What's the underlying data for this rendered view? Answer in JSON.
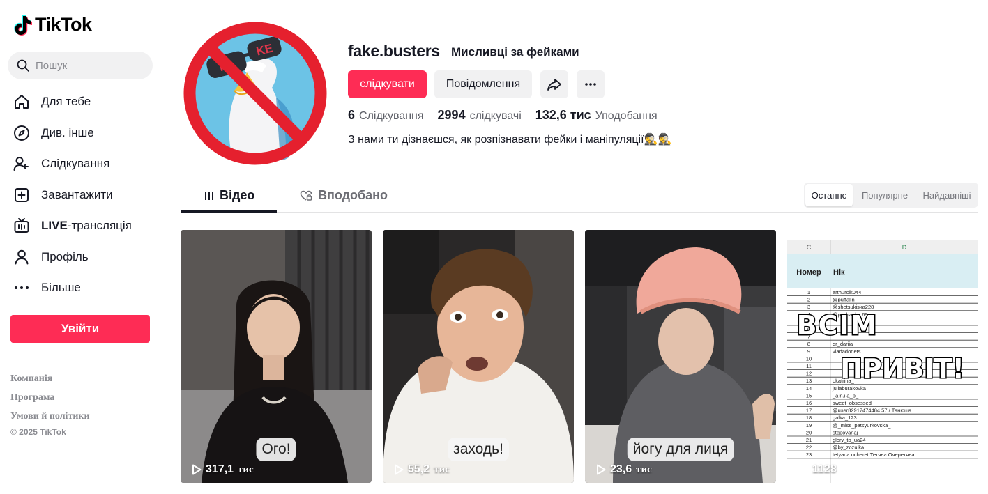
{
  "app": {
    "name": "TikTok"
  },
  "sidebar": {
    "search_placeholder": "Пошук",
    "nav": [
      {
        "label": "Для тебе",
        "icon": "home-icon"
      },
      {
        "label": "Див. інше",
        "icon": "compass-icon"
      },
      {
        "label": "Слідкування",
        "icon": "following-icon"
      },
      {
        "label": "Завантажити",
        "icon": "upload-icon"
      },
      {
        "label_bold": "LIVE",
        "label": "-трансляція",
        "icon": "live-icon"
      },
      {
        "label": "Профіль",
        "icon": "profile-icon"
      },
      {
        "label": "Більше",
        "icon": "more-dots-icon"
      }
    ],
    "login_label": "Увійти",
    "footer": {
      "company": "Компанія",
      "program": "Програма",
      "terms": "Умови й політики",
      "copyright": "© 2025 TikTok"
    }
  },
  "profile": {
    "username": "fake.busters",
    "nickname": "Мисливці за фейками",
    "follow_label": "слідкувати",
    "message_label": "Повідомлення",
    "stats": {
      "following": "6",
      "following_label": "Слідкування",
      "followers": "2994",
      "followers_label": "слідкувачі",
      "likes": "132,6 тис",
      "likes_label": "Уподобання"
    },
    "bio": "З нами ти дізнаєшся, як розпізнавати фейки і маніпуляції🕵️🕵️",
    "avatar_text": {
      "left": "FA",
      "right": "KE"
    }
  },
  "tabs": {
    "videos": "Відео",
    "liked": "Вподобано"
  },
  "sort": {
    "latest": "Останнє",
    "popular": "Популярне",
    "oldest": "Найдавніші"
  },
  "videos": [
    {
      "caption": "Ого!",
      "views": "317,1",
      "unit": "тис"
    },
    {
      "caption": "заходь!",
      "views": "55,2",
      "unit": "тис"
    },
    {
      "caption": "йогу для лиця",
      "views": "23,6",
      "unit": "тис"
    },
    {
      "caption": "",
      "views": "1128",
      "unit": ""
    }
  ],
  "sheet": {
    "col_c": "C",
    "col_d": "D",
    "header_num": "Номер",
    "header_nick": "Нік",
    "overlay_line1": "ВСІМ",
    "overlay_line2": "ПРИВІТ!",
    "rows": [
      [
        "1",
        "arthurcik044"
      ],
      [
        "2",
        "@puffalin"
      ],
      [
        "3",
        "@shetsukiska228"
      ],
      [
        "4",
        "@pachanka.69"
      ],
      [
        "5",
        ""
      ],
      [
        "6",
        ""
      ],
      [
        "7",
        ""
      ],
      [
        "8",
        "dr_dariia"
      ],
      [
        "9",
        "vladadonets"
      ],
      [
        "10",
        ""
      ],
      [
        "11",
        ""
      ],
      [
        "12",
        ""
      ],
      [
        "13",
        "okatrina_"
      ],
      [
        "14",
        "juliaburakovka"
      ],
      [
        "15",
        "_a.n.i.a_b_"
      ],
      [
        "16",
        "sweet_obsessed"
      ],
      [
        "17",
        "@user82917474484 57 / Танюша"
      ],
      [
        "18",
        "galka_123"
      ],
      [
        "19",
        "@_miss_patsyurkovska_"
      ],
      [
        "20",
        "stepovanaj"
      ],
      [
        "21",
        "glory_to_ua24"
      ],
      [
        "22",
        "@by_zozulka"
      ],
      [
        "23",
        "tetyana ocheret Тетяна Очеретяна"
      ]
    ]
  },
  "colors": {
    "accent": "#fe2c55",
    "text": "#161823",
    "muted": "#8a8b91",
    "surface": "#f1f1f2"
  }
}
